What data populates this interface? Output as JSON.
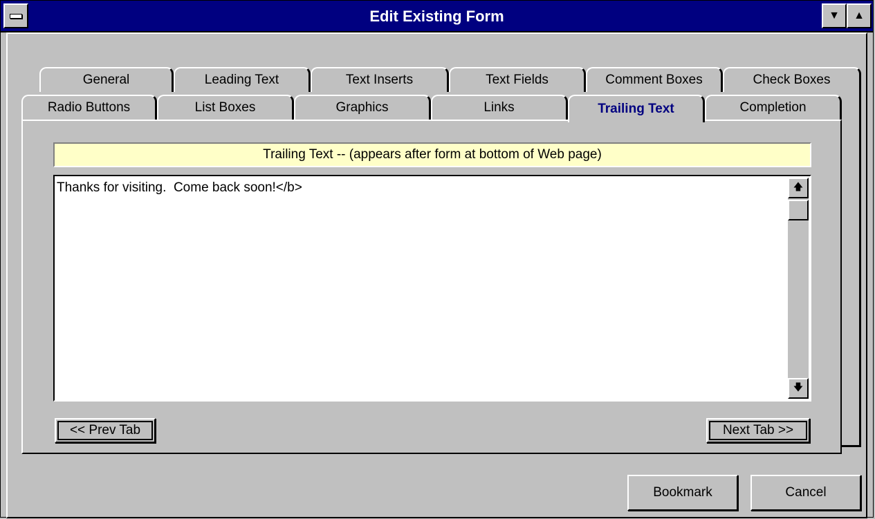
{
  "window": {
    "title": "Edit Existing Form"
  },
  "tabs_row1": [
    "General",
    "Leading Text",
    "Text Inserts",
    "Text Fields",
    "Comment Boxes",
    "Check Boxes"
  ],
  "tabs_row2": [
    "Radio Buttons",
    "List Boxes",
    "Graphics",
    "Links",
    "Trailing Text",
    "Completion"
  ],
  "active_tab": "Trailing Text",
  "section": {
    "header": "Trailing Text -- (appears after form at bottom of Web page)",
    "text_value": "Thanks for visiting.  Come back soon!</b>"
  },
  "nav": {
    "prev_label": "<< Prev Tab",
    "next_label": "Next Tab >>"
  },
  "footer": {
    "bookmark_label": "Bookmark",
    "cancel_label": "Cancel"
  },
  "colors": {
    "titlebar": "#000080",
    "face": "#c0c0c0",
    "header_band": "#ffffc8",
    "active_tab_text": "#000080"
  }
}
